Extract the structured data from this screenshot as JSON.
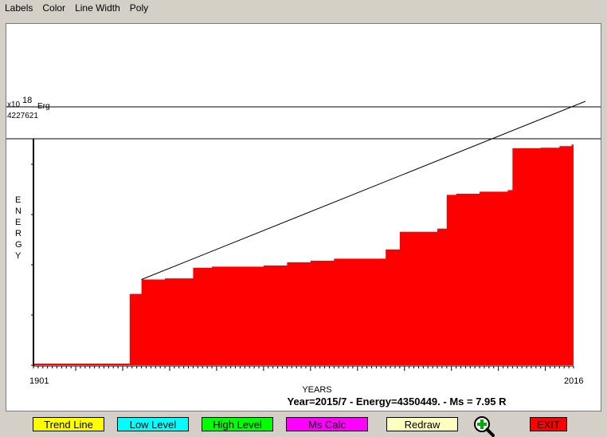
{
  "menu": [
    "Labels",
    "Color",
    "Line Width",
    "Poly"
  ],
  "chart_data": {
    "type": "area",
    "xlabel": "YEARS",
    "ylabel": "ENERGY",
    "ylabel_letters": [
      "E",
      "N",
      "E",
      "R",
      "G",
      "Y"
    ],
    "y_unit_prefix": "x10",
    "y_unit_exponent": "18",
    "y_unit_suffix": "Erg",
    "y_max_label": "4227621",
    "x_start_label": "1901",
    "x_end_label": "2016",
    "xlim": [
      1901,
      2016
    ],
    "ylim": [
      0,
      4227621
    ],
    "high_level": 4227621,
    "series_color": "#ff0000",
    "steps": [
      [
        1901,
        0
      ],
      [
        1921.5,
        1330000
      ],
      [
        1924,
        1600000
      ],
      [
        1929,
        1620000
      ],
      [
        1935,
        1820000
      ],
      [
        1939,
        1840000
      ],
      [
        1950,
        1860000
      ],
      [
        1955,
        1920000
      ],
      [
        1960,
        1950000
      ],
      [
        1965,
        1990000
      ],
      [
        1976,
        2160000
      ],
      [
        1979,
        2490000
      ],
      [
        1987,
        2550000
      ],
      [
        1989,
        3180000
      ],
      [
        1991,
        3200000
      ],
      [
        1996,
        3240000
      ],
      [
        2002,
        3270000
      ],
      [
        2003,
        4050000
      ],
      [
        2009,
        4060000
      ],
      [
        2013,
        4090000
      ],
      [
        2015.6,
        4120000
      ]
    ],
    "trend_line": {
      "x": [
        1924,
        2016
      ],
      "y": [
        1600000,
        4820000
      ]
    }
  },
  "status": "Year=2015/7 - Energy=4350449. - Ms = 7.95 R",
  "buttons": {
    "trend": {
      "label": "Trend Line",
      "color": "#ffff00"
    },
    "low": {
      "label": "Low Level",
      "color": "#00ffff"
    },
    "high": {
      "label": "High Level",
      "color": "#00ff00"
    },
    "ms": {
      "label": "Ms Calc",
      "color": "#ff00ff"
    },
    "redraw": {
      "label": "Redraw",
      "color": "#ffffc0"
    },
    "zoom_icon": "zoom-in-icon",
    "exit": {
      "label": "EXIT",
      "color": "#ff0000"
    }
  }
}
